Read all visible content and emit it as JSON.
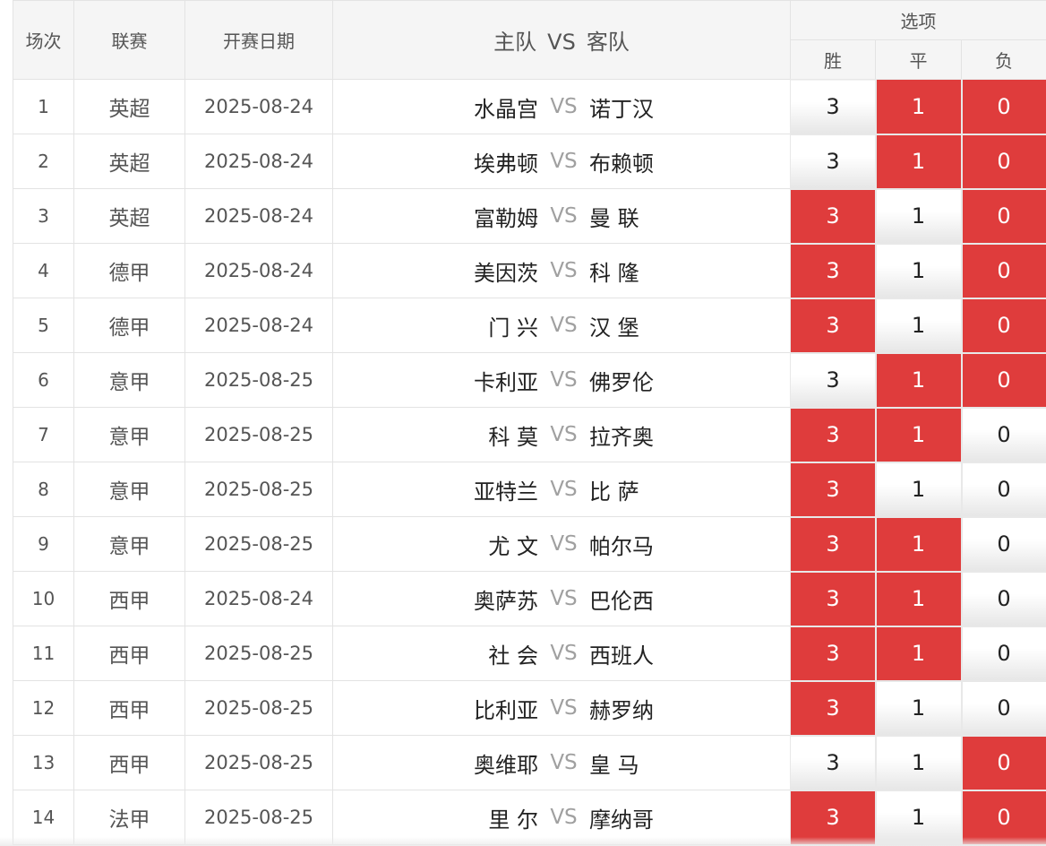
{
  "header": {
    "seq": "场次",
    "league": "联赛",
    "date": "开赛日期",
    "home": "主队",
    "vs": "VS",
    "away": "客队",
    "options": "选项",
    "win": "胜",
    "draw": "平",
    "loss": "负"
  },
  "colors": {
    "selected": "#df3c3c",
    "unselected": "#f2f2f2"
  },
  "matches": [
    {
      "seq": "1",
      "league": "英超",
      "date": "2025-08-24",
      "home": "水晶宫",
      "vs": "VS",
      "away": "诺丁汉",
      "win": "3",
      "draw": "1",
      "loss": "0",
      "sel": [
        false,
        true,
        true
      ]
    },
    {
      "seq": "2",
      "league": "英超",
      "date": "2025-08-24",
      "home": "埃弗顿",
      "vs": "VS",
      "away": "布赖顿",
      "win": "3",
      "draw": "1",
      "loss": "0",
      "sel": [
        false,
        true,
        true
      ]
    },
    {
      "seq": "3",
      "league": "英超",
      "date": "2025-08-24",
      "home": "富勒姆",
      "vs": "VS",
      "away": "曼 联",
      "win": "3",
      "draw": "1",
      "loss": "0",
      "sel": [
        true,
        false,
        true
      ]
    },
    {
      "seq": "4",
      "league": "德甲",
      "date": "2025-08-24",
      "home": "美因茨",
      "vs": "VS",
      "away": "科 隆",
      "win": "3",
      "draw": "1",
      "loss": "0",
      "sel": [
        true,
        false,
        true
      ]
    },
    {
      "seq": "5",
      "league": "德甲",
      "date": "2025-08-24",
      "home": "门 兴",
      "vs": "VS",
      "away": "汉 堡",
      "win": "3",
      "draw": "1",
      "loss": "0",
      "sel": [
        true,
        false,
        true
      ]
    },
    {
      "seq": "6",
      "league": "意甲",
      "date": "2025-08-25",
      "home": "卡利亚",
      "vs": "VS",
      "away": "佛罗伦",
      "win": "3",
      "draw": "1",
      "loss": "0",
      "sel": [
        false,
        true,
        true
      ]
    },
    {
      "seq": "7",
      "league": "意甲",
      "date": "2025-08-25",
      "home": "科 莫",
      "vs": "VS",
      "away": "拉齐奥",
      "win": "3",
      "draw": "1",
      "loss": "0",
      "sel": [
        true,
        true,
        false
      ]
    },
    {
      "seq": "8",
      "league": "意甲",
      "date": "2025-08-25",
      "home": "亚特兰",
      "vs": "VS",
      "away": "比 萨",
      "win": "3",
      "draw": "1",
      "loss": "0",
      "sel": [
        true,
        false,
        false
      ]
    },
    {
      "seq": "9",
      "league": "意甲",
      "date": "2025-08-25",
      "home": "尤 文",
      "vs": "VS",
      "away": "帕尔马",
      "win": "3",
      "draw": "1",
      "loss": "0",
      "sel": [
        true,
        true,
        false
      ]
    },
    {
      "seq": "10",
      "league": "西甲",
      "date": "2025-08-24",
      "home": "奥萨苏",
      "vs": "VS",
      "away": "巴伦西",
      "win": "3",
      "draw": "1",
      "loss": "0",
      "sel": [
        true,
        true,
        false
      ]
    },
    {
      "seq": "11",
      "league": "西甲",
      "date": "2025-08-25",
      "home": "社 会",
      "vs": "VS",
      "away": "西班人",
      "win": "3",
      "draw": "1",
      "loss": "0",
      "sel": [
        true,
        true,
        false
      ]
    },
    {
      "seq": "12",
      "league": "西甲",
      "date": "2025-08-25",
      "home": "比利亚",
      "vs": "VS",
      "away": "赫罗纳",
      "win": "3",
      "draw": "1",
      "loss": "0",
      "sel": [
        true,
        false,
        false
      ]
    },
    {
      "seq": "13",
      "league": "西甲",
      "date": "2025-08-25",
      "home": "奥维耶",
      "vs": "VS",
      "away": "皇 马",
      "win": "3",
      "draw": "1",
      "loss": "0",
      "sel": [
        false,
        false,
        true
      ]
    },
    {
      "seq": "14",
      "league": "法甲",
      "date": "2025-08-25",
      "home": "里 尔",
      "vs": "VS",
      "away": "摩纳哥",
      "win": "3",
      "draw": "1",
      "loss": "0",
      "sel": [
        true,
        false,
        true
      ]
    }
  ]
}
